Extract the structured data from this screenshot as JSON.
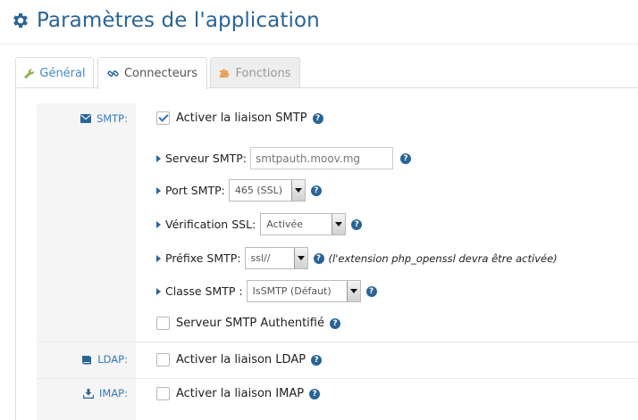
{
  "header": {
    "title": "Paramètres de l'application",
    "icon": "gear-icon"
  },
  "tabs": [
    {
      "label": "Général",
      "icon": "wrench-icon",
      "state": "inactive"
    },
    {
      "label": "Connecteurs",
      "icon": "link-icon",
      "state": "active"
    },
    {
      "label": "Fonctions",
      "icon": "puzzle-icon",
      "state": "disabled"
    }
  ],
  "smtp": {
    "label": "SMTP:",
    "enable_label": "Activer la liaison SMTP",
    "enabled": true,
    "server_label": "Serveur SMTP:",
    "server_value": "smtpauth.moov.mg",
    "port_label": "Port SMTP:",
    "port_value": "465 (SSL)",
    "ssl_label": "Vérification SSL:",
    "ssl_value": "Activée",
    "prefix_label": "Préfixe SMTP:",
    "prefix_value": "ssl//",
    "prefix_note": "(l'extension php_openssl devra être activée)",
    "class_label": "Classe SMTP :",
    "class_value": "IsSMTP (Défaut)",
    "auth_label": "Serveur SMTP Authentifié",
    "auth_enabled": false
  },
  "ldap": {
    "label": "LDAP:",
    "enable_label": "Activer la liaison LDAP",
    "enabled": false
  },
  "imap": {
    "label": "IMAP:",
    "enable_label": "Activer la liaison IMAP",
    "enabled": false
  },
  "colors": {
    "accent": "#2a6496",
    "link": "#428bca",
    "muted_tab": "#eeeeee"
  }
}
